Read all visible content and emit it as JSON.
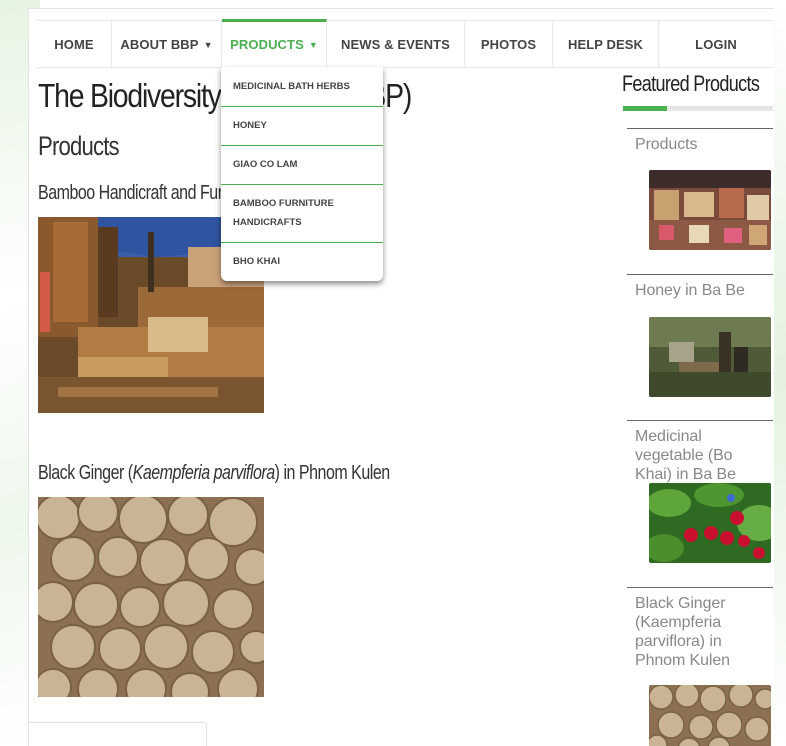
{
  "nav": {
    "items": [
      {
        "label": "HOME",
        "caret": false
      },
      {
        "label": "ABOUT BBP",
        "caret": true
      },
      {
        "label": "PRODUCTS",
        "caret": true,
        "active": true
      },
      {
        "label": "NEWS & EVENTS",
        "caret": false
      },
      {
        "label": "PHOTOS",
        "caret": false
      },
      {
        "label": "HELP DESK",
        "caret": false
      },
      {
        "label": "LOGIN",
        "caret": false
      }
    ],
    "caret_glyph": "▼"
  },
  "dropdown": {
    "items": [
      "MEDICINAL BATH HERBS",
      "HONEY",
      "GIAO CO LAM",
      "BAMBOO FURNITURE HANDICRAFTS",
      "BHO KHAI"
    ]
  },
  "main": {
    "title_visible_start": "The Biodiversity-ba",
    "title_visible_end": "BP)",
    "subtitle": "Products",
    "items": [
      {
        "heading": "Bamboo Handicraft and Furnit"
      },
      {
        "heading_prefix": "Black Ginger (",
        "heading_italic": "Kaempferia parviflora",
        "heading_suffix": ") in Phnom Kulen"
      }
    ]
  },
  "sidebar": {
    "title": "Featured Products",
    "products": [
      {
        "title": "Products"
      },
      {
        "title": "Honey in Ba Be"
      },
      {
        "title": "Medicinal vegetable (Bo Khai) in Ba Be"
      },
      {
        "title": "Black Ginger (Kaempferia parviflora) in Phnom Kulen"
      }
    ]
  },
  "colors": {
    "accent": "#4caf50",
    "text": "#333333",
    "muted": "#888888"
  }
}
